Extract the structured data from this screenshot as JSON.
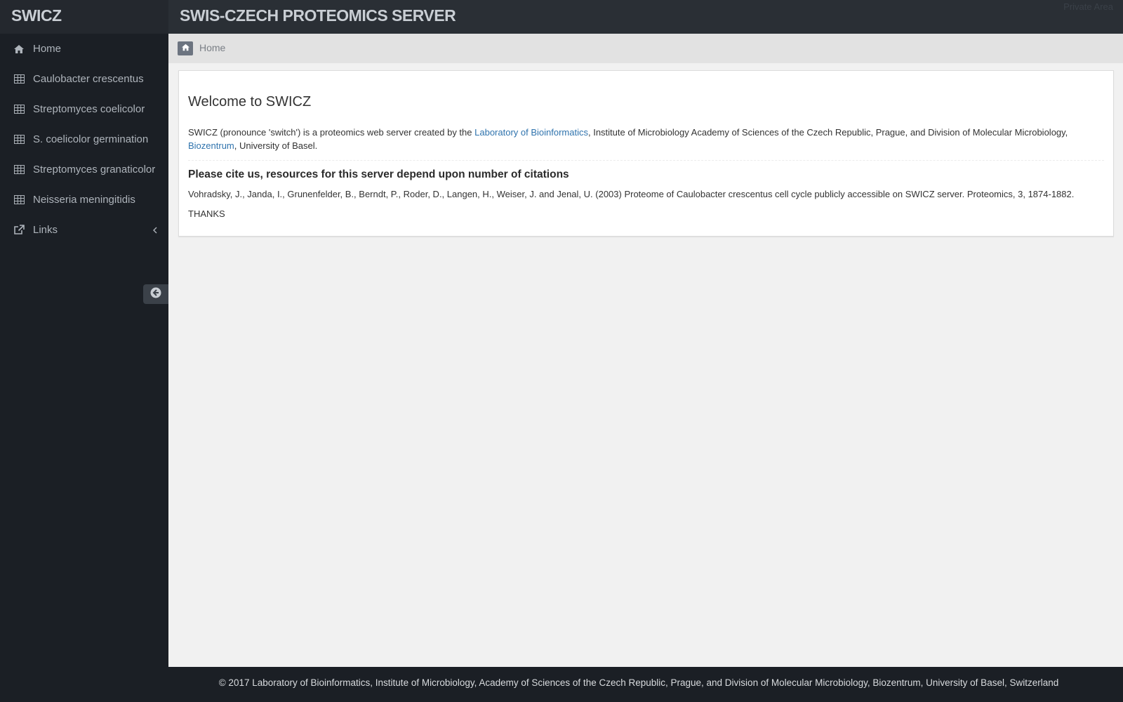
{
  "header": {
    "brand": "SWICZ",
    "title": "SWIS-CZECH PROTEOMICS SERVER",
    "private_link": "Private Area"
  },
  "sidebar": {
    "items": [
      {
        "label": "Home",
        "icon": "home-icon"
      },
      {
        "label": "Caulobacter crescentus",
        "icon": "table-icon"
      },
      {
        "label": "Streptomyces coelicolor",
        "icon": "table-icon"
      },
      {
        "label": "S. coelicolor germination",
        "icon": "table-icon"
      },
      {
        "label": "Streptomyces granaticolor",
        "icon": "table-icon"
      },
      {
        "label": "Neisseria meningitidis",
        "icon": "table-icon"
      },
      {
        "label": "Links",
        "icon": "external-link-icon"
      }
    ],
    "collapse_icon": "arrow-circle-left-icon"
  },
  "breadcrumb": {
    "current": "Home"
  },
  "main": {
    "welcome": "Welcome to SWICZ",
    "intro_prefix": "SWICZ (pronounce 'switch') is a proteomics web server created by the ",
    "intro_link1": "Laboratory of Bioinformatics",
    "intro_middle": ", Institute of Microbiology Academy of Sciences of the Czech Republic, Prague, and Division of Molecular Microbiology, ",
    "intro_link2": "Biozentrum",
    "intro_suffix": ", University of Basel.",
    "cite_heading": "Please cite us, resources for this server depend upon number of citations",
    "citation": "Vohradsky, J., Janda, I., Grunenfelder, B., Berndt, P., Roder, D., Langen, H., Weiser, J. and Jenal, U. (2003) Proteome of Caulobacter crescentus cell cycle publicly accessible on SWICZ server. Proteomics, 3, 1874-1882.",
    "thanks": "THANKS"
  },
  "footer": {
    "text": "© 2017 Laboratory of Bioinformatics, Institute of Microbiology, Academy of Sciences of the Czech Republic, Prague, and Division of Molecular Microbiology, Biozentrum, University of Basel, Switzerland"
  },
  "colors": {
    "sidebar_bg": "#1b1f25",
    "topbar_bg": "#2a2f35",
    "link": "#2f73ad",
    "content_bg": "#f1f1f1"
  }
}
